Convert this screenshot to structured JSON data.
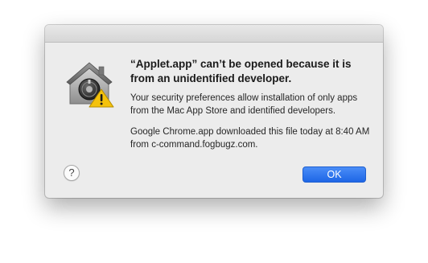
{
  "dialog": {
    "title": "“Applet.app” can’t be opened because it is from an unidentified developer.",
    "message": "Your security preferences allow installation of only apps from the Mac App Store and identified developers.",
    "source_info": "Google Chrome.app downloaded this file today at 8:40 AM from c-command.fogbugz.com.",
    "help_label": "?",
    "ok_label": "OK",
    "icon": "gatekeeper-house-lock-warning-icon"
  },
  "colors": {
    "ok_button": "#1e66e6",
    "window_bg": "#ececec",
    "warning_yellow": "#f4c20d"
  }
}
